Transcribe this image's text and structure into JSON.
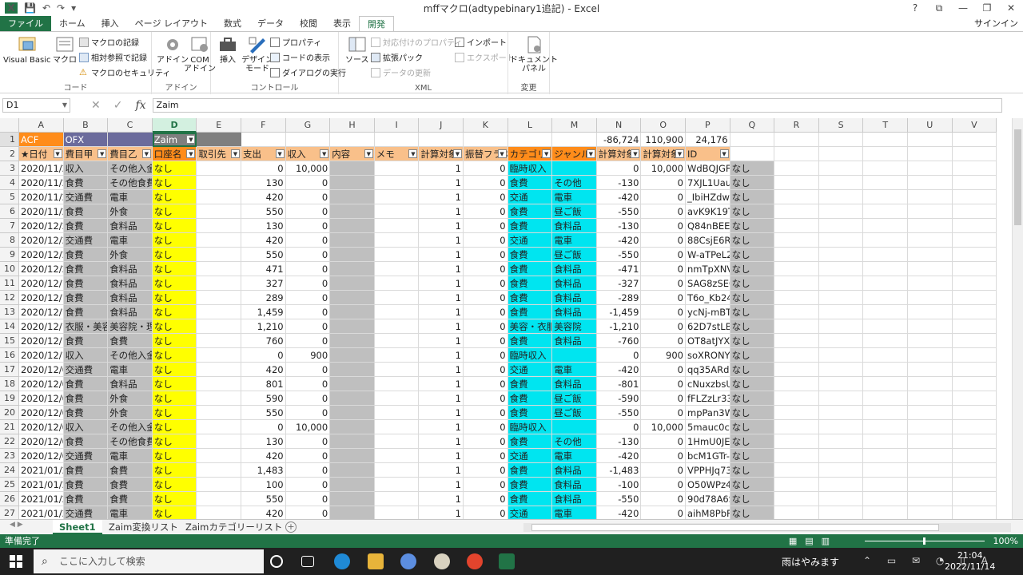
{
  "window": {
    "title": "mffマクロ(adtypebinary1追記) - Excel",
    "help": "?",
    "restore": "⧉",
    "minimize": "—",
    "maximize": "❐",
    "close": "✕"
  },
  "tabs": [
    "ファイル",
    "ホーム",
    "挿入",
    "ページ レイアウト",
    "数式",
    "データ",
    "校閲",
    "表示",
    "開発"
  ],
  "signin": "サインイン",
  "ribbon": {
    "code": {
      "label": "コード",
      "visual_basic": "Visual Basic",
      "macro": "マクロ",
      "record": "マクロの記録",
      "relative": "相対参照で記録",
      "security": "マクロのセキュリティ"
    },
    "addins": {
      "label": "アドイン",
      "addin": "アドイン",
      "com": "COM\nアドイン"
    },
    "controls": {
      "label": "コントロール",
      "insert": "挿入",
      "design": "デザイン\nモード",
      "properties": "プロパティ",
      "view_code": "コードの表示",
      "dialog": "ダイアログの実行"
    },
    "xml": {
      "label": "XML",
      "source": "ソース",
      "map_props": "対応付けのプロパティ",
      "expansion": "拡張パック",
      "refresh": "データの更新",
      "import": "インポート",
      "export": "エクスポート"
    },
    "modify": {
      "label": "変更",
      "doc_panel": "ドキュメント\nパネル"
    }
  },
  "formula_bar": {
    "name_box": "D1",
    "value": "Zaim",
    "cancel": "✕",
    "enter": "✓",
    "fx": "fx"
  },
  "columns": [
    "A",
    "B",
    "C",
    "D",
    "E",
    "F",
    "G",
    "H",
    "I",
    "J",
    "K",
    "L",
    "M",
    "N",
    "O",
    "P",
    "Q",
    "R",
    "S",
    "T",
    "U",
    "V"
  ],
  "row1": {
    "A": "ACF",
    "B": "OFX",
    "D": "Zaim",
    "N": "-86,724",
    "O": "110,900",
    "P": "24,176"
  },
  "headers": [
    "★日付",
    "費目甲",
    "費目乙",
    "口座名",
    "取引先",
    "支出",
    "収入",
    "内容",
    "メモ",
    "計算対象",
    "振替フラグ",
    "カテゴリ",
    "ジャンル",
    "計算対象",
    "計算対象",
    "ID"
  ],
  "rows": [
    [
      "2020/11/24",
      "収入",
      "その他入金",
      "なし",
      "",
      "0",
      "10,000",
      "",
      "",
      "1",
      "0",
      "臨時収入",
      "",
      "0",
      "10,000",
      "WdBQJGF",
      "なし"
    ],
    [
      "2020/11/24",
      "食費",
      "その他食費",
      "なし",
      "",
      "130",
      "0",
      "",
      "",
      "1",
      "0",
      "食費",
      "その他",
      "-130",
      "0",
      "7XJL1Uau",
      "なし"
    ],
    [
      "2020/11/24",
      "交通費",
      "電車",
      "なし",
      "",
      "420",
      "0",
      "",
      "",
      "1",
      "0",
      "交通",
      "電車",
      "-420",
      "0",
      "_IbiHZdwg",
      "なし"
    ],
    [
      "2020/11/24",
      "食費",
      "外食",
      "なし",
      "",
      "550",
      "0",
      "",
      "",
      "1",
      "0",
      "食費",
      "昼ご飯",
      "-550",
      "0",
      "avK9K19T",
      "なし"
    ],
    [
      "2020/12/22",
      "食費",
      "食料品",
      "なし",
      "",
      "130",
      "0",
      "",
      "",
      "1",
      "0",
      "食費",
      "食料品",
      "-130",
      "0",
      "Q84nBEEV",
      "なし"
    ],
    [
      "2020/12/22",
      "交通費",
      "電車",
      "なし",
      "",
      "420",
      "0",
      "",
      "",
      "1",
      "0",
      "交通",
      "電車",
      "-420",
      "0",
      "88CsjE6Rt",
      "なし"
    ],
    [
      "2020/12/22",
      "食費",
      "外食",
      "なし",
      "",
      "550",
      "0",
      "",
      "",
      "1",
      "0",
      "食費",
      "昼ご飯",
      "-550",
      "0",
      "W-aTPeL2",
      "なし"
    ],
    [
      "2020/12/20",
      "食費",
      "食料品",
      "なし",
      "",
      "471",
      "0",
      "",
      "",
      "1",
      "0",
      "食費",
      "食料品",
      "-471",
      "0",
      "nmTpXNV",
      "なし"
    ],
    [
      "2020/12/16",
      "食費",
      "食料品",
      "なし",
      "",
      "327",
      "0",
      "",
      "",
      "1",
      "0",
      "食費",
      "食料品",
      "-327",
      "0",
      "SAG8zSEC",
      "なし"
    ],
    [
      "2020/12/15",
      "食費",
      "食料品",
      "なし",
      "",
      "289",
      "0",
      "",
      "",
      "1",
      "0",
      "食費",
      "食料品",
      "-289",
      "0",
      "T6o_Kb24",
      "なし"
    ],
    [
      "2020/12/12",
      "食費",
      "食料品",
      "なし",
      "",
      "1,459",
      "0",
      "",
      "",
      "1",
      "0",
      "食費",
      "食料品",
      "-1,459",
      "0",
      "ycNj-mBT",
      "なし"
    ],
    [
      "2020/12/11",
      "衣服・美容",
      "美容院・理",
      "なし",
      "",
      "1,210",
      "0",
      "",
      "",
      "1",
      "0",
      "美容・衣服",
      "美容院",
      "-1,210",
      "0",
      "62D7stLB",
      "なし"
    ],
    [
      "2020/12/10",
      "食費",
      "食費",
      "なし",
      "",
      "760",
      "0",
      "",
      "",
      "1",
      "0",
      "食費",
      "食料品",
      "-760",
      "0",
      "OT8atJYXI",
      "なし"
    ],
    [
      "2020/12/10",
      "収入",
      "その他入金",
      "なし",
      "",
      "0",
      "900",
      "",
      "",
      "1",
      "0",
      "臨時収入",
      "",
      "0",
      "900",
      "soXRONY",
      "なし"
    ],
    [
      "2020/12/09",
      "交通費",
      "電車",
      "なし",
      "",
      "420",
      "0",
      "",
      "",
      "1",
      "0",
      "交通",
      "電車",
      "-420",
      "0",
      "qq35ARdp",
      "なし"
    ],
    [
      "2020/12/09",
      "食費",
      "食料品",
      "なし",
      "",
      "801",
      "0",
      "",
      "",
      "1",
      "0",
      "食費",
      "食料品",
      "-801",
      "0",
      "cNuxzbsU",
      "なし"
    ],
    [
      "2020/12/09",
      "食費",
      "外食",
      "なし",
      "",
      "590",
      "0",
      "",
      "",
      "1",
      "0",
      "食費",
      "昼ご飯",
      "-590",
      "0",
      "fFLZzLr33",
      "なし"
    ],
    [
      "2020/12/02",
      "食費",
      "外食",
      "なし",
      "",
      "550",
      "0",
      "",
      "",
      "1",
      "0",
      "食費",
      "昼ご飯",
      "-550",
      "0",
      "mpPan3W",
      "なし"
    ],
    [
      "2020/12/01",
      "収入",
      "その他入金",
      "なし",
      "",
      "0",
      "10,000",
      "",
      "",
      "1",
      "0",
      "臨時収入",
      "",
      "0",
      "10,000",
      "5mauc0cw",
      "なし"
    ],
    [
      "2020/12/01",
      "食費",
      "その他食費",
      "なし",
      "",
      "130",
      "0",
      "",
      "",
      "1",
      "0",
      "食費",
      "その他",
      "-130",
      "0",
      "1HmU0JE",
      "なし"
    ],
    [
      "2020/12/01",
      "交通費",
      "電車",
      "なし",
      "",
      "420",
      "0",
      "",
      "",
      "1",
      "0",
      "交通",
      "電車",
      "-420",
      "0",
      "bcM1GTr-",
      "なし"
    ],
    [
      "2021/01/27",
      "食費",
      "食費",
      "なし",
      "",
      "1,483",
      "0",
      "",
      "",
      "1",
      "0",
      "食費",
      "食料品",
      "-1,483",
      "0",
      "VPPHJq73",
      "なし"
    ],
    [
      "2021/01/27",
      "食費",
      "食費",
      "なし",
      "",
      "100",
      "0",
      "",
      "",
      "1",
      "0",
      "食費",
      "食料品",
      "-100",
      "0",
      "O50WPz43",
      "なし"
    ],
    [
      "2021/01/26",
      "食費",
      "食費",
      "なし",
      "",
      "550",
      "0",
      "",
      "",
      "1",
      "0",
      "食費",
      "食料品",
      "-550",
      "0",
      "90d78A6S",
      "なし"
    ],
    [
      "2021/01/26",
      "交通費",
      "電車",
      "なし",
      "",
      "420",
      "0",
      "",
      "",
      "1",
      "0",
      "交通",
      "電車",
      "-420",
      "0",
      "aihM8PbF",
      "なし"
    ]
  ],
  "sheets": [
    "Sheet1",
    "Zaim変換リスト",
    "Zaimカテゴリーリスト"
  ],
  "status": {
    "ready": "準備完了",
    "zoom": "100%"
  },
  "taskbar": {
    "search_placeholder": "ここに入力して検索",
    "weather": "雨はやみます",
    "time": "21:04",
    "date": "2022/11/14"
  }
}
